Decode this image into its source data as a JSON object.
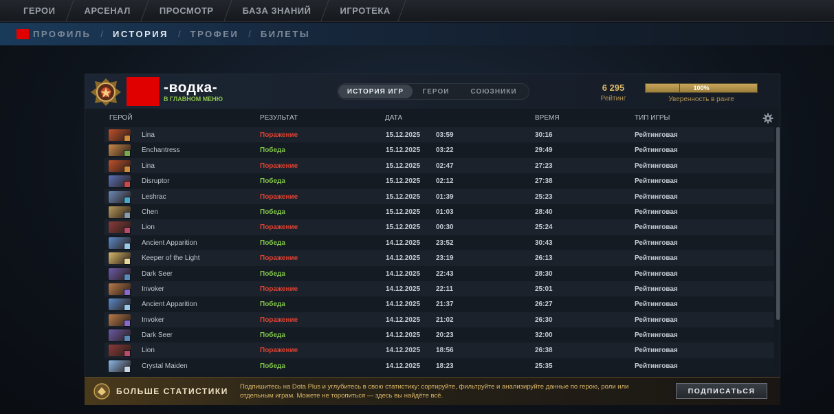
{
  "topnav": {
    "items": [
      {
        "label": "ГЕРОИ"
      },
      {
        "label": "АРСЕНАЛ"
      },
      {
        "label": "ПРОСМОТР"
      },
      {
        "label": "БАЗА ЗНАНИЙ"
      },
      {
        "label": "ИГРОТЕКА"
      }
    ]
  },
  "subnav": {
    "items": [
      {
        "label": "ПРОФИЛЬ"
      },
      {
        "label": "ИСТОРИЯ"
      },
      {
        "label": "ТРОФЕИ"
      },
      {
        "label": "БИЛЕТЫ"
      }
    ],
    "separator": "/",
    "active_index": 1
  },
  "player": {
    "name": "-водка-",
    "status": "В ГЛАВНОМ МЕНЮ",
    "avatar_color": "#e00000"
  },
  "tabs": [
    {
      "label": "ИСТОРИЯ ИГР",
      "active": true
    },
    {
      "label": "ГЕРОИ",
      "active": false
    },
    {
      "label": "СОЮЗНИКИ",
      "active": false
    }
  ],
  "rating": {
    "value": "6 295",
    "label": "Рейтинг"
  },
  "confidence": {
    "percent_text": "100%",
    "fraction": 1.0,
    "label": "Уверенность в ранге"
  },
  "table": {
    "headers": {
      "hero": "ГЕРОЙ",
      "result": "РЕЗУЛЬТАТ",
      "date": "ДАТА",
      "duration": "ВРЕМЯ",
      "type": "ТИП ИГРЫ"
    },
    "rows": [
      {
        "hero": "Lina",
        "result": "Поражение",
        "win": false,
        "date": "15.12.2025",
        "time": "03:59",
        "duration": "30:16",
        "type": "Рейтинговая",
        "hero_color": "#c0502a",
        "sub_color": "#d08a3a"
      },
      {
        "hero": "Enchantress",
        "result": "Победа",
        "win": true,
        "date": "15.12.2025",
        "time": "03:22",
        "duration": "29:49",
        "type": "Рейтинговая",
        "hero_color": "#c88a4a",
        "sub_color": "#7aa84a"
      },
      {
        "hero": "Lina",
        "result": "Поражение",
        "win": false,
        "date": "15.12.2025",
        "time": "02:47",
        "duration": "27:23",
        "type": "Рейтинговая",
        "hero_color": "#c0502a",
        "sub_color": "#d08a3a"
      },
      {
        "hero": "Disruptor",
        "result": "Победа",
        "win": true,
        "date": "15.12.2025",
        "time": "02:12",
        "duration": "27:38",
        "type": "Рейтинговая",
        "hero_color": "#5a70b8",
        "sub_color": "#c84a4a"
      },
      {
        "hero": "Leshrac",
        "result": "Поражение",
        "win": false,
        "date": "15.12.2025",
        "time": "01:39",
        "duration": "25:23",
        "type": "Рейтинговая",
        "hero_color": "#6a8ab8",
        "sub_color": "#4aa8c8"
      },
      {
        "hero": "Chen",
        "result": "Победа",
        "win": true,
        "date": "15.12.2025",
        "time": "01:03",
        "duration": "28:40",
        "type": "Рейтинговая",
        "hero_color": "#b89a5a",
        "sub_color": "#8a9aa8"
      },
      {
        "hero": "Lion",
        "result": "Поражение",
        "win": false,
        "date": "15.12.2025",
        "time": "00:30",
        "duration": "25:24",
        "type": "Рейтинговая",
        "hero_color": "#8a3a3a",
        "sub_color": "#b84a6a"
      },
      {
        "hero": "Ancient Apparition",
        "result": "Победа",
        "win": true,
        "date": "14.12.2025",
        "time": "23:52",
        "duration": "30:43",
        "type": "Рейтинговая",
        "hero_color": "#5a8ac8",
        "sub_color": "#9ac8e8"
      },
      {
        "hero": "Keeper of the Light",
        "result": "Поражение",
        "win": false,
        "date": "14.12.2025",
        "time": "23:19",
        "duration": "26:13",
        "type": "Рейтинговая",
        "hero_color": "#d8b86a",
        "sub_color": "#e8d89a"
      },
      {
        "hero": "Dark Seer",
        "result": "Победа",
        "win": true,
        "date": "14.12.2025",
        "time": "22:43",
        "duration": "28:30",
        "type": "Рейтинговая",
        "hero_color": "#6a5aa8",
        "sub_color": "#5a8ab8"
      },
      {
        "hero": "Invoker",
        "result": "Поражение",
        "win": false,
        "date": "14.12.2025",
        "time": "22:11",
        "duration": "25:01",
        "type": "Рейтинговая",
        "hero_color": "#b87a4a",
        "sub_color": "#8a6ac8"
      },
      {
        "hero": "Ancient Apparition",
        "result": "Победа",
        "win": true,
        "date": "14.12.2025",
        "time": "21:37",
        "duration": "26:27",
        "type": "Рейтинговая",
        "hero_color": "#5a8ac8",
        "sub_color": "#9ac8e8"
      },
      {
        "hero": "Invoker",
        "result": "Поражение",
        "win": false,
        "date": "14.12.2025",
        "time": "21:02",
        "duration": "26:30",
        "type": "Рейтинговая",
        "hero_color": "#b87a4a",
        "sub_color": "#8a6ac8"
      },
      {
        "hero": "Dark Seer",
        "result": "Победа",
        "win": true,
        "date": "14.12.2025",
        "time": "20:23",
        "duration": "32:00",
        "type": "Рейтинговая",
        "hero_color": "#6a5aa8",
        "sub_color": "#5a8ab8"
      },
      {
        "hero": "Lion",
        "result": "Поражение",
        "win": false,
        "date": "14.12.2025",
        "time": "18:56",
        "duration": "26:38",
        "type": "Рейтинговая",
        "hero_color": "#8a3a3a",
        "sub_color": "#b84a6a"
      },
      {
        "hero": "Crystal Maiden",
        "result": "Победа",
        "win": true,
        "date": "14.12.2025",
        "time": "18:23",
        "duration": "25:35",
        "type": "Рейтинговая",
        "hero_color": "#8ab8e8",
        "sub_color": "#c8d8e8"
      }
    ]
  },
  "promo": {
    "title": "БОЛЬШЕ СТАТИСТИКИ",
    "text": "Подпишитесь на Dota Plus и углубитесь в свою статистику: сортируйте, фильтруйте и анализируйте данные по герою, роли или отдельным играм. Можете не торопиться — здесь вы найдёте всё.",
    "button": "ПОДПИСАТЬСЯ"
  },
  "icons": {
    "settings": "gear-icon",
    "rank": "rank-medal-icon",
    "promo": "dota-plus-icon"
  }
}
